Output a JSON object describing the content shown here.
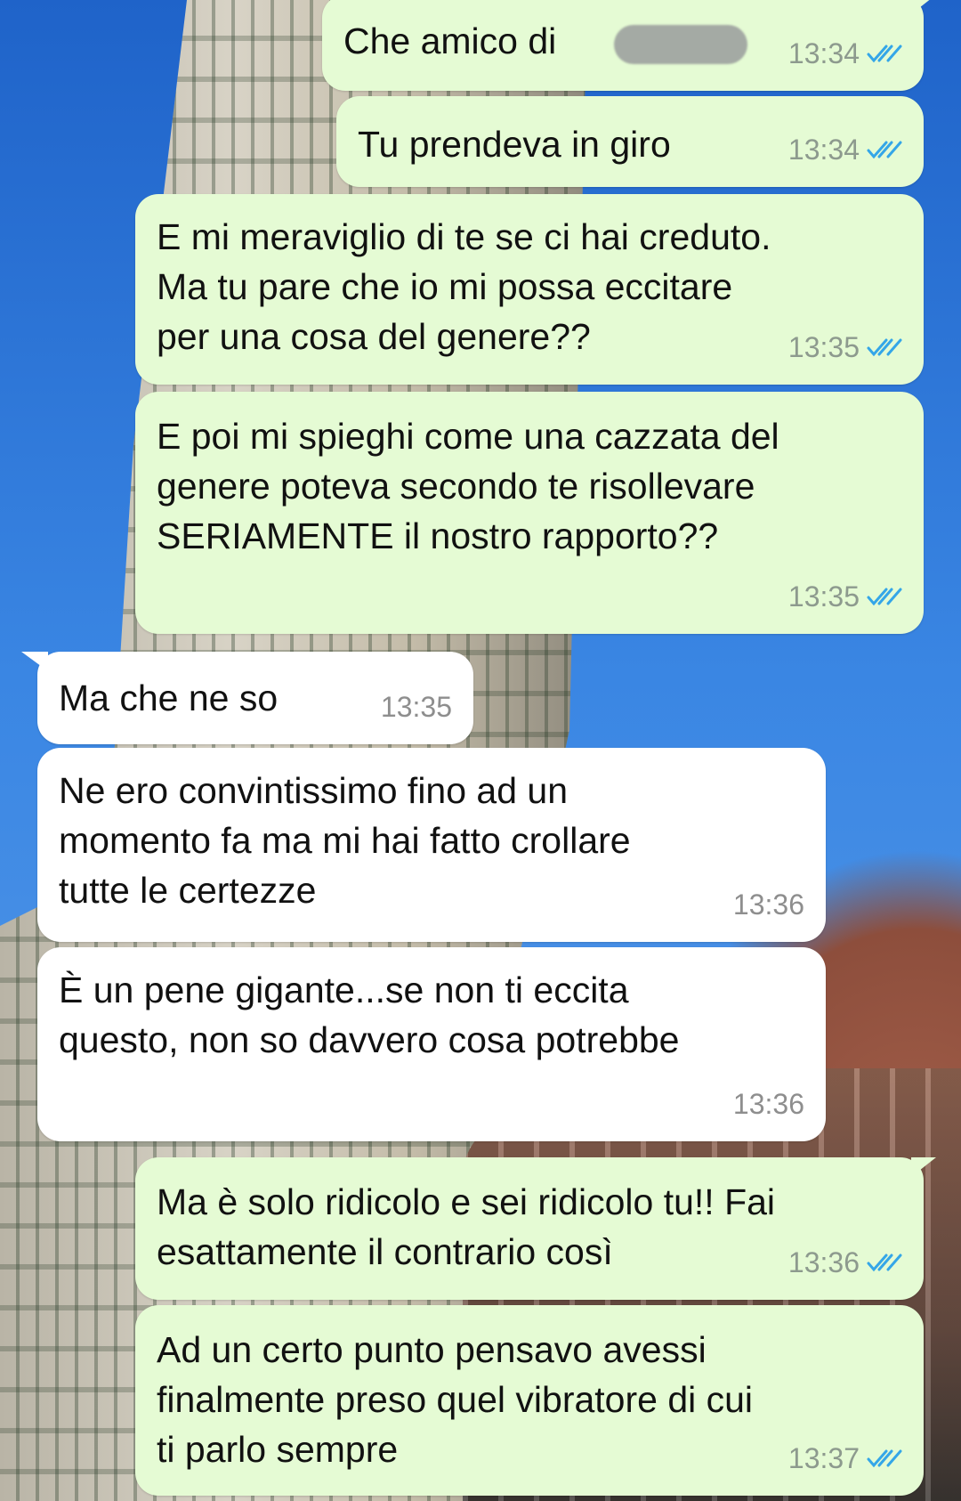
{
  "messages": [
    {
      "direction": "outgoing",
      "text": "Che amico di",
      "time": "13:34",
      "status": "read",
      "redacted_name": true
    },
    {
      "direction": "outgoing",
      "text": "Tu prendeva in giro",
      "time": "13:34",
      "status": "read"
    },
    {
      "direction": "outgoing",
      "text": "E mi meraviglio di te se ci hai creduto.\nMa tu pare che io mi possa eccitare\nper una cosa del genere??",
      "time": "13:35",
      "status": "read"
    },
    {
      "direction": "outgoing",
      "text": "E poi mi spieghi come una cazzata del\ngenere poteva secondo te risollevare\nSERIAMENTE il nostro rapporto??",
      "time": "13:35",
      "status": "read"
    },
    {
      "direction": "incoming",
      "text": "Ma che ne so",
      "time": "13:35"
    },
    {
      "direction": "incoming",
      "text": "Ne ero convintissimo fino ad un\nmomento fa ma mi hai fatto crollare\ntutte le certezze",
      "time": "13:36"
    },
    {
      "direction": "incoming",
      "text": "È un pene gigante...se non ti eccita\nquesto, non so davvero cosa potrebbe",
      "time": "13:36"
    },
    {
      "direction": "outgoing",
      "text": "Ma è solo ridicolo e sei ridicolo tu!! Fai\nesattamente il contrario così",
      "time": "13:36",
      "status": "read"
    },
    {
      "direction": "outgoing",
      "text": "Ad un certo punto pensavo avessi\nfinalmente preso quel vibratore di cui\nti parlo sempre",
      "time": "13:37",
      "status": "read"
    }
  ],
  "colors": {
    "outgoing_bubble": "#e5fbd4",
    "incoming_bubble": "#ffffff",
    "read_ticks": "#34a6e8"
  },
  "icons": {
    "read_receipt": "double-check-icon"
  }
}
